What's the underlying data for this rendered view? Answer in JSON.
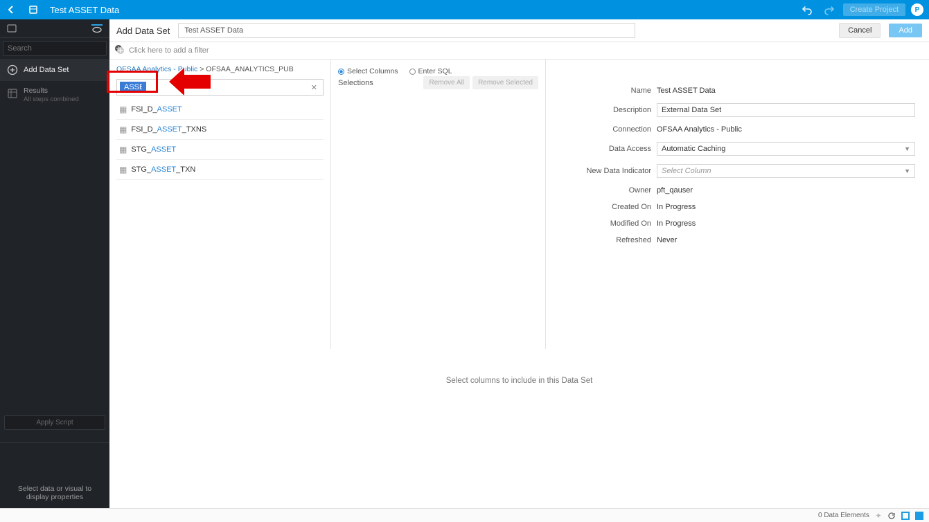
{
  "topbar": {
    "title": "Test ASSET Data",
    "create_project_label": "Create Project",
    "avatar_initial": "P"
  },
  "sidebar": {
    "search_placeholder": "Search",
    "add_data_set_label": "Add Data Set",
    "results_label": "Results",
    "results_sub": "All steps combined",
    "apply_script_label": "Apply Script",
    "hint": "Select data or visual to display properties"
  },
  "main_header": {
    "title": "Add Data Set",
    "name_value": "Test ASSET Data",
    "cancel_label": "Cancel",
    "add_label": "Add"
  },
  "filter_placeholder": "Click here to add a filter",
  "breadcrumb": {
    "link1": "OFSAA Analytics - Public",
    "sep": ">",
    "current": "OFSAA_ANALYTICS_PUB"
  },
  "search_value": "ASSET",
  "results": [
    {
      "prefix": "FSI_D_",
      "match": "ASSET",
      "suffix": ""
    },
    {
      "prefix": "FSI_D_",
      "match": "ASSET",
      "suffix": "_TXNS"
    },
    {
      "prefix": "STG_",
      "match": "ASSET",
      "suffix": ""
    },
    {
      "prefix": "STG_",
      "match": "ASSET",
      "suffix": "_TXN"
    }
  ],
  "selections": {
    "label": "Selections",
    "remove_all": "Remove All",
    "remove_selected": "Remove Selected"
  },
  "mode": {
    "select_columns": "Select Columns",
    "enter_sql": "Enter SQL"
  },
  "form": {
    "name_label": "Name",
    "name_value": "Test ASSET Data",
    "description_label": "Description",
    "description_value": "External Data Set",
    "connection_label": "Connection",
    "connection_value": "OFSAA Analytics - Public",
    "data_access_label": "Data Access",
    "data_access_value": "Automatic Caching",
    "new_data_indicator_label": "New Data Indicator",
    "new_data_indicator_placeholder": "Select Column",
    "owner_label": "Owner",
    "owner_value": "pft_qauser",
    "created_on_label": "Created On",
    "created_on_value": "In Progress",
    "modified_on_label": "Modified On",
    "modified_on_value": "In Progress",
    "refreshed_label": "Refreshed",
    "refreshed_value": "Never"
  },
  "bottom_hint": "Select columns to include in this Data Set",
  "statusbar": {
    "elements_label": "0 Data Elements"
  }
}
